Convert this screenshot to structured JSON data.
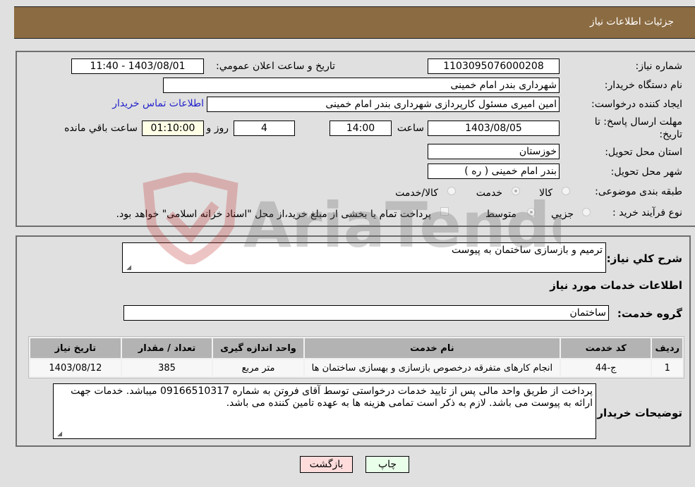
{
  "header": {
    "title": "جزئیات اطلاعات نیاز"
  },
  "fields": {
    "need_number_label": "شماره نیاز:",
    "need_number": "1103095076000208",
    "announce_label": "تاریخ و ساعت اعلان عمومي:",
    "announce_value": "1403/08/01 - 11:40",
    "buyer_org_label": "نام دستگاه خریدار:",
    "buyer_org": "شهرداری بندر امام خمینی",
    "creator_label": "ایجاد کننده درخواست:",
    "creator": "امین امیری مسئول کارپردازی شهرداری بندر امام خمینی",
    "contact_link": "اطلاعات تماس خریدار",
    "deadline_label": "مهلت ارسال پاسخ: تا تاریخ:",
    "deadline_date": "1403/08/05",
    "time_label": "ساعت",
    "deadline_time": "14:00",
    "days_value": "4",
    "days_label": "روز و",
    "remaining_value": "01:10:00",
    "remaining_label": "ساعت باقي مانده",
    "province_label": "استان محل تحویل:",
    "province": "خوزستان",
    "city_label": "شهر محل تحویل:",
    "city": "بندر امام خمینی ( ره )",
    "category_label": "طبقه بندی موضوعی:",
    "category_options": [
      {
        "label": "کالا",
        "checked": false
      },
      {
        "label": "خدمت",
        "checked": true
      },
      {
        "label": "کالا/خدمت",
        "checked": false
      }
    ],
    "process_label": "نوع فرآیند خرید :",
    "process_options": [
      {
        "label": "جزيي",
        "checked": false
      },
      {
        "label": "متوسط",
        "checked": true
      }
    ],
    "treasury_note": "پرداخت تمام یا بخشی از مبلغ خرید،از محل \"اسناد خزانه اسلامی\" خواهد بود."
  },
  "details": {
    "summary_label": "شرح کلي نیاز:",
    "summary_value": "ترمیم و بازسازی ساختمان به پیوست",
    "services_heading": "اطلاعات خدمات مورد نیاز",
    "service_group_label": "گروه خدمت:",
    "service_group_value": "ساختمان",
    "table": {
      "headers": [
        "ردیف",
        "کد خدمت",
        "نام خدمت",
        "واحد اندازه گیری",
        "تعداد / مقدار",
        "تاریخ نیاز"
      ],
      "rows": [
        [
          "1",
          "ج-44",
          "انجام کارهای متفرقه درخصوص بازسازی و بهسازی ساختمان ها",
          "متر مربع",
          "385",
          "1403/08/12"
        ]
      ]
    },
    "buyer_notes_label": "توضیحات خریدار:",
    "buyer_notes_value": "پرداخت از طریق واحد مالی پس از تایید خدمات درخواستی توسط آقای فروتن به شماره 09166510317 میباشد. خدمات جهت ارائه به پیوست می باشد. لازم به ذکر است تمامی هزینه ها به عهده تامین کننده می باشد."
  },
  "buttons": {
    "print": "چاپ",
    "back": "بازگشت"
  },
  "watermark": {
    "text": "AriaTender.neT"
  }
}
